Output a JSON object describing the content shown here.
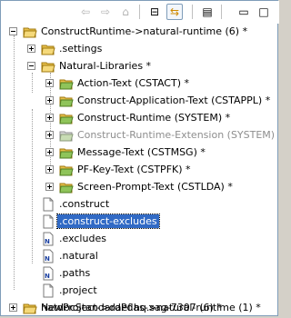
{
  "toolbar": {
    "buttons": [
      {
        "name": "back-button",
        "icon": "arrow-left-icon",
        "glyph": "⇦",
        "enabled": false
      },
      {
        "name": "forward-button",
        "icon": "arrow-right-icon",
        "glyph": "⇨",
        "enabled": false
      },
      {
        "name": "home-button",
        "icon": "home-icon",
        "glyph": "⌂",
        "enabled": false
      },
      {
        "name": "collapse-all-button",
        "icon": "collapse-all-icon",
        "glyph": "⊟",
        "enabled": true
      },
      {
        "name": "link-with-editor-button",
        "icon": "link-sync-icon",
        "glyph": "⇆",
        "enabled": true,
        "active": true
      },
      {
        "name": "view-menu-button",
        "icon": "view-menu-icon",
        "glyph": "▤",
        "enabled": true
      },
      {
        "name": "minimize-button",
        "icon": "minimize-icon",
        "glyph": "▭",
        "enabled": true
      },
      {
        "name": "maximize-button",
        "icon": "maximize-icon",
        "glyph": "□",
        "enabled": true
      }
    ]
  },
  "tree": {
    "root1_label": "ConstructRuntime->natural-runtime (6) *",
    "settings_label": ".settings",
    "natlib_label": "Natural-Libraries *",
    "libs": [
      {
        "label": "Action-Text (CSTACT) *",
        "gray": false
      },
      {
        "label": "Construct-Application-Text (CSTAPPL) *",
        "gray": false
      },
      {
        "label": "Construct-Runtime (SYSTEM) *",
        "gray": false
      },
      {
        "label": "Construct-Runtime-Extension (SYSTEM)",
        "gray": true
      },
      {
        "label": "Message-Text (CSTMSG) *",
        "gray": false
      },
      {
        "label": "PF-Key-Text (CSTPFK) *",
        "gray": false
      },
      {
        "label": "Screen-Prompt-Text (CSTLDA) *",
        "gray": false
      }
    ],
    "files": [
      {
        "label": ".construct",
        "icon": "file-icon",
        "selected": false
      },
      {
        "label": ".construct-excludes",
        "icon": "file-icon",
        "selected": true
      },
      {
        "label": ".excludes",
        "icon": "natural-file-icon",
        "selected": false
      },
      {
        "label": ".natural",
        "icon": "natural-file-icon",
        "selected": false
      },
      {
        "label": ".paths",
        "icon": "natural-file-icon",
        "selected": false
      },
      {
        "label": ".project",
        "icon": "file-icon",
        "selected": false
      }
    ],
    "root2_label": "natdocStandardPdas->natural-runtime (1) *",
    "root3_label": "NewProject->daef.hq.sag-7307 (6) *"
  },
  "colors": {
    "selection": "#316ac5",
    "folder": "#e8c04a",
    "library_folder": "#8fc45a",
    "gray_text": "#8e8e8e"
  }
}
